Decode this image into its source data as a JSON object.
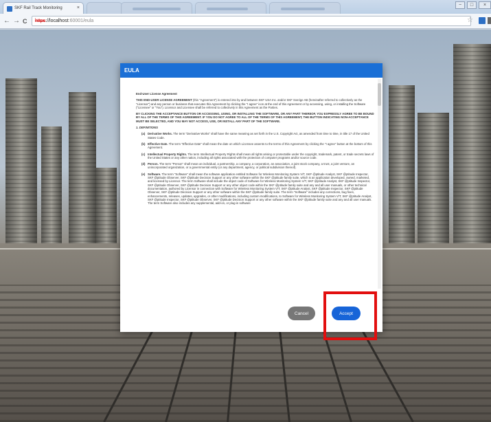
{
  "browser": {
    "active_tab_title": "SKF Rail Track Monitoring",
    "tab_close": "×",
    "nav_back": "←",
    "nav_forward": "→",
    "nav_reload": "C",
    "url_scheme": "https",
    "url_host": "://localhost",
    "url_path": ":60001/eula",
    "bookmark_star": "☆",
    "win_minimize": "−",
    "win_maximize": "□",
    "win_close": "×"
  },
  "modal": {
    "title": "EULA",
    "heading": "End-User License Agreement",
    "intro_lead": "THIS END-USER LICENSE AGREEMENT",
    "intro_rest": " (this \"Agreement\") is entered into by and between SKF USA Inc. and/or SKF Sverige AB (hereinafter referred to collectively as the \"Licensor\") and any person or business that executes this Agreement by clicking the \"I agree\" icon at the end of this Agreement or by accessing, using, or installing the Software (\"Licensee\" or \"You\"). Licensor and Licensee shall be referred to collectively in this Agreement as the Parties.",
    "acceptance_clause": "BY CLICKING THE ACCEPTANCE BUTTON OR ACCESSING, USING, OR INSTALLING THE SOFTWARE, OR ANY PART THEREOF, YOU EXPRESSLY AGREE TO BE BOUND BY ALL OF THE TERMS OF THIS AGREEMENT. IF YOU DO NOT AGREE TO ALL OF THE TERMS OF THIS AGREEMENT, THE BUTTON INDICATING NON-ACCEPTANCE MUST BE SELECTED, AND YOU MAY NOT ACCESS, USE, OR INSTALL ANY PART OF THE SOFTWARE.",
    "section_title": "1.  DEFINITIONS",
    "definitions": [
      {
        "letter": "(a)",
        "term": "Derivative Works.",
        "text": " The term \"Derivative Works\" shall have the same meaning as set forth in the U.S. Copyright Act, as amended from time to time, in title 17 of the United States Code."
      },
      {
        "letter": "(b)",
        "term": "Effective Date.",
        "text": " The term \"Effective Date\" shall mean the date on which Licensee assents to the terms of this Agreement by clicking the \"I agree\" button at the bottom of this Agreement."
      },
      {
        "letter": "(c)",
        "term": "Intellectual Property Rights.",
        "text": " The term Intellectual Property Rights shall mean all rights arising or protectable under the copyright, trademark, patent, or trade secrets laws of the United States or any other nation, including all rights associated with the protection of computer programs and/or source code."
      },
      {
        "letter": "(d)",
        "term": "Person.",
        "text": " The term \"Person\" shall mean an individual, a partnership, a company, a corporation, an association, a joint stock company, a trust, a joint venture, an unincorporated organization, or a governmental entity (or any department, agency, or political subdivision thereof)."
      },
      {
        "letter": "(e)",
        "term": "Software.",
        "text": " The term \"Software\" shall mean the software application entitled Software for Wireless Monitoring System V/T, SKF @ptitude Analyst, SKF @ptitude Inspector, SKF @ptitude Observer, SKF @ptitude Decision Support or any other software within the SKF @ptitude family suite, which is an application developed, owned, marketed, and licensed by Licensor. The term Software shall include the object code of Software for Wireless Monitoring System V/T, SKF @ptitude Analyst, SKF @ptitude Inspector, SKF @ptitude Observer, SKF @ptitude Decision Support or any other object code within the SKF @ptitude family suite and any and all user manuals, or other technical documentation, authored by Licensor in connection with Software for Wireless Monitoring System V/T, SKF @ptitude Analyst, SKF @ptitude Inspector, SKF @ptitude Observer, SKF @ptitude Decision Support or any other software within the SKF @ptitude family suite. The term \"Software\" includes any corrections, bug fixes, enhancements, releases, updates, upgrades, or other modifications, including custom modifications, to Software for Wireless Monitoring System V/T, SKF @ptitude Analyst, SKF @ptitude Inspector, SKF @ptitude Observer, SKF @ptitude Decision Support or any other software within the SKF @ptitude family suite and any and all user manuals. The term Software also includes any supplemental, add-on, or plug-in software"
      }
    ],
    "cancel_label": "Cancel",
    "accept_label": "Accept"
  },
  "colors": {
    "header_blue": "#1a6fd6",
    "accept_blue": "#1764d8",
    "cancel_gray": "#777777",
    "highlight_red": "#e20f0f"
  }
}
